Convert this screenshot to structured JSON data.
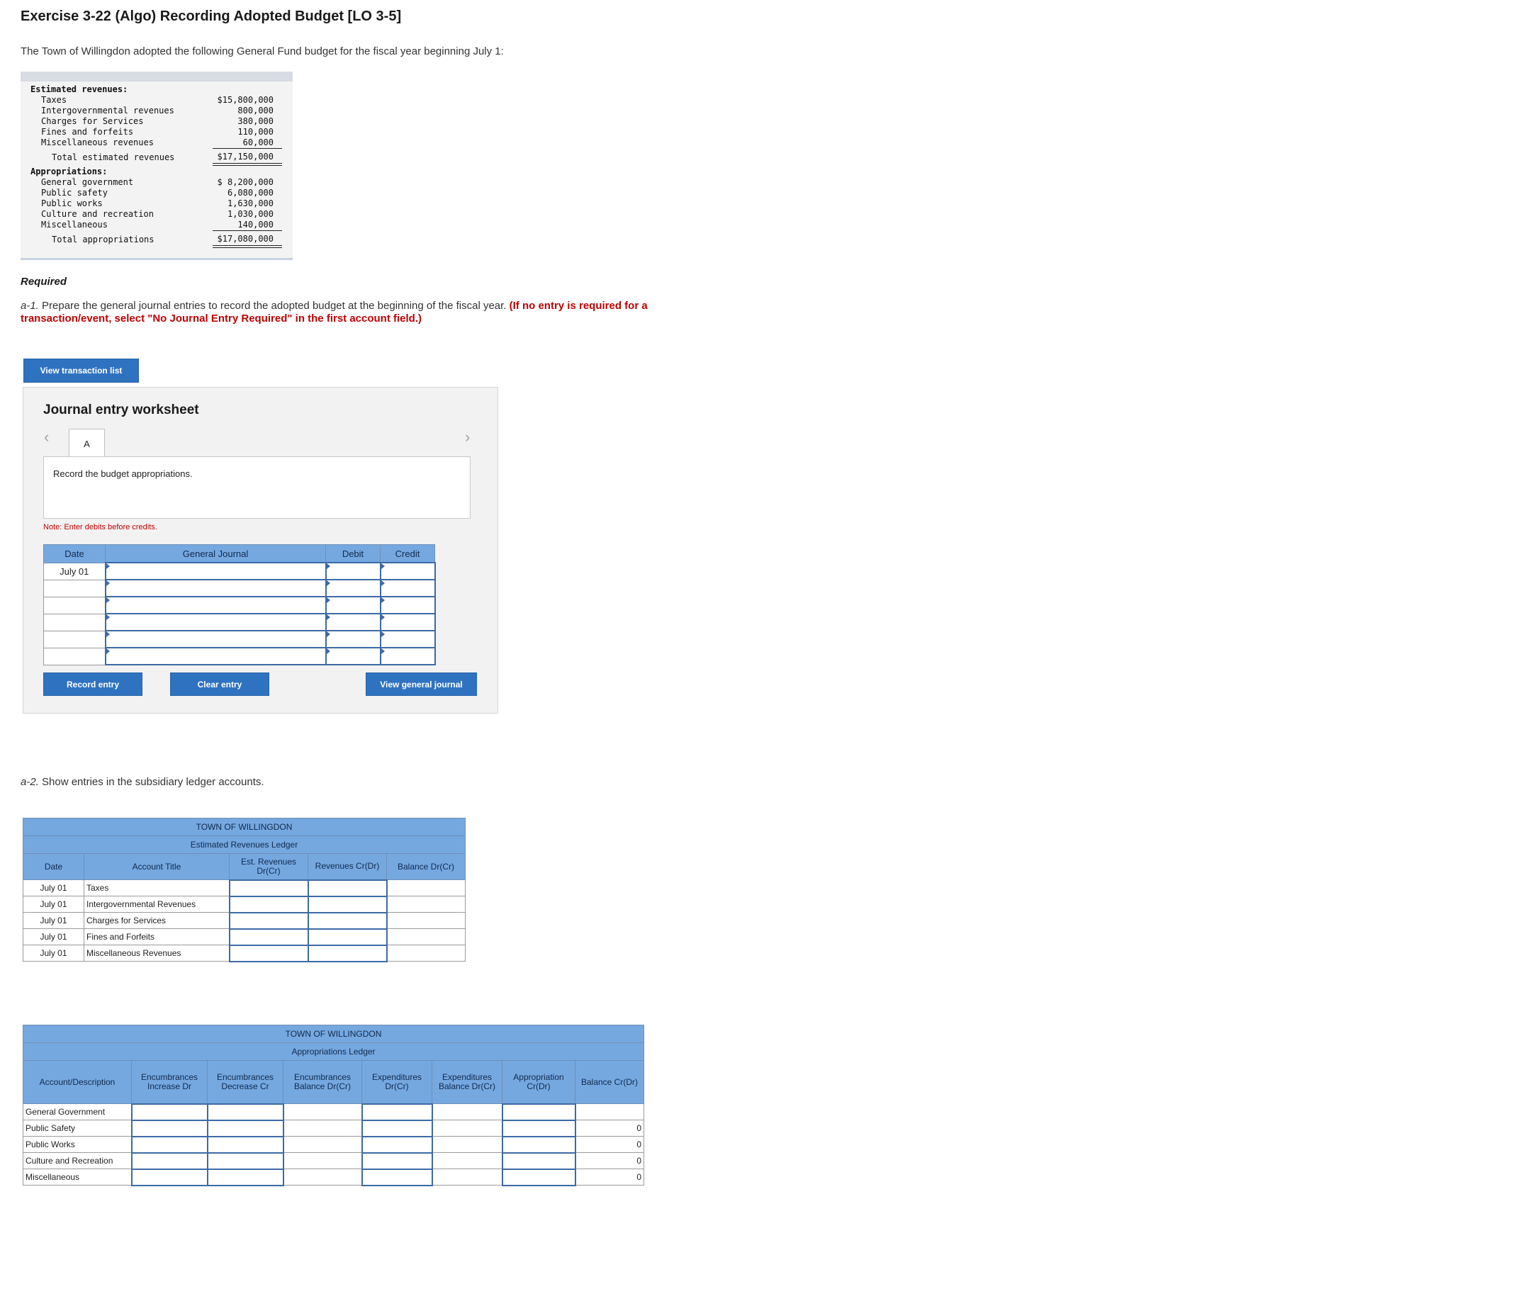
{
  "title": "Exercise 3-22 (Algo) Recording Adopted Budget [LO 3-5]",
  "intro": "The Town of Willingdon adopted the following General Fund budget for the fiscal year beginning July 1:",
  "budget": {
    "est_rev_header": "Estimated revenues:",
    "revenues": [
      {
        "label": "Taxes",
        "amount": "$15,800,000"
      },
      {
        "label": "Intergovernmental revenues",
        "amount": "800,000"
      },
      {
        "label": "Charges for Services",
        "amount": "380,000"
      },
      {
        "label": "Fines and forfeits",
        "amount": "110,000"
      },
      {
        "label": "Miscellaneous revenues",
        "amount": "60,000"
      }
    ],
    "total_rev_label": "Total estimated revenues",
    "total_rev": "$17,150,000",
    "approp_header": "Appropriations:",
    "appropriations": [
      {
        "label": "General government",
        "amount": "$ 8,200,000"
      },
      {
        "label": "Public safety",
        "amount": "6,080,000"
      },
      {
        "label": "Public works",
        "amount": "1,630,000"
      },
      {
        "label": "Culture and recreation",
        "amount": "1,030,000"
      },
      {
        "label": "Miscellaneous",
        "amount": "140,000"
      }
    ],
    "total_approp_label": "Total appropriations",
    "total_approp": "$17,080,000"
  },
  "required": "Required",
  "a1_prefix": "a-1.",
  "a1_text": " Prepare the general journal entries to record the adopted budget at the beginning of the fiscal year. ",
  "a1_red": "(If no entry is required for a transaction/event, select \"No Journal Entry Required\" in the first account field.)",
  "view_transaction_list": "View transaction list",
  "worksheet": {
    "title": "Journal entry worksheet",
    "tab": "A",
    "description": "Record the budget appropriations.",
    "note": "Note: Enter debits before credits.",
    "headers": {
      "date": "Date",
      "gj": "General Journal",
      "debit": "Debit",
      "credit": "Credit"
    },
    "first_date": "July 01",
    "record_entry": "Record entry",
    "clear_entry": "Clear entry",
    "view_general_journal": "View general journal"
  },
  "a2_prefix": "a-2.",
  "a2_text": " Show entries in the subsidiary ledger accounts.",
  "rev_ledger": {
    "title1": "TOWN OF WILLINGDON",
    "title2": "Estimated Revenues Ledger",
    "headers": {
      "date": "Date",
      "account": "Account Title",
      "est": "Est. Revenues Dr(Cr)",
      "rev": "Revenues Cr(Dr)",
      "bal": "Balance Dr(Cr)"
    },
    "rows": [
      {
        "date": "July 01",
        "account": "Taxes"
      },
      {
        "date": "July 01",
        "account": "Intergovernmental Revenues"
      },
      {
        "date": "July 01",
        "account": "Charges for Services"
      },
      {
        "date": "July 01",
        "account": "Fines and Forfeits"
      },
      {
        "date": "July 01",
        "account": "Miscellaneous Revenues"
      }
    ]
  },
  "approp_ledger": {
    "title1": "TOWN OF WILLINGDON",
    "title2": "Appropriations Ledger",
    "headers": {
      "account": "Account/Description",
      "enc_inc": "Encumbrances Increase Dr",
      "enc_dec": "Encumbrances Decrease Cr",
      "enc_bal": "Encumbrances Balance Dr(Cr)",
      "exp": "Expenditures Dr(Cr)",
      "exp_bal": "Expenditures Balance Dr(Cr)",
      "approp": "Appropriation Cr(Dr)",
      "bal": "Balance Cr(Dr)"
    },
    "rows": [
      {
        "account": "General Government",
        "balance": ""
      },
      {
        "account": "Public Safety",
        "balance": "0"
      },
      {
        "account": "Public Works",
        "balance": "0"
      },
      {
        "account": "Culture and Recreation",
        "balance": "0"
      },
      {
        "account": "Miscellaneous",
        "balance": "0"
      }
    ]
  }
}
